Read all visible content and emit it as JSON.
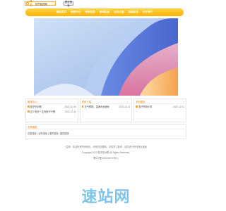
{
  "search": {
    "label": "搜索",
    "value": "请开始搜索",
    "button_label": "提交搜索"
  },
  "nav": {
    "items": [
      "网站首页",
      "资讯中心",
      "你所在的",
      "新闻热点",
      "企业公告",
      "经典名言",
      "关于我们"
    ]
  },
  "panels": [
    {
      "title": "新闻中心",
      "rows": [
        {
          "text": "帽子的对联",
          "date": "2022-12-06"
        },
        {
          "text": "这个老天一生你就不兴啊",
          "date": "2022-12-11"
        }
      ]
    },
    {
      "title": "资讯介绍",
      "rows": [
        {
          "text": "天气预报，雪满天地我地",
          "date": "2022-12-11"
        }
      ]
    },
    {
      "title": "资讯图片",
      "rows": [
        {
          "text": "帽子的快乐事",
          "date": "2022-12-11"
        }
      ]
    }
  ],
  "links": {
    "title": "友情链接",
    "line": "百度搜索 | 谷歌搜索 | 搜狗搜索 | 搜搜搜索"
  },
  "footer": {
    "notice": "*注明：本站所有所有资讯，均来自互联网，仅供学习参考，请勿进行任何商业用途",
    "copyright": "Copyright 2022 帽子的对联 All Rights Reserved.",
    "icp": "蜀ICP备2022034700号-1"
  },
  "watermark": "速站网",
  "colors": {
    "accent": "#f5a623",
    "nav_top": "#ffd24a",
    "nav_bottom": "#ffb400",
    "panel_title": "#e67e00",
    "watermark": "#7fc4ea"
  }
}
